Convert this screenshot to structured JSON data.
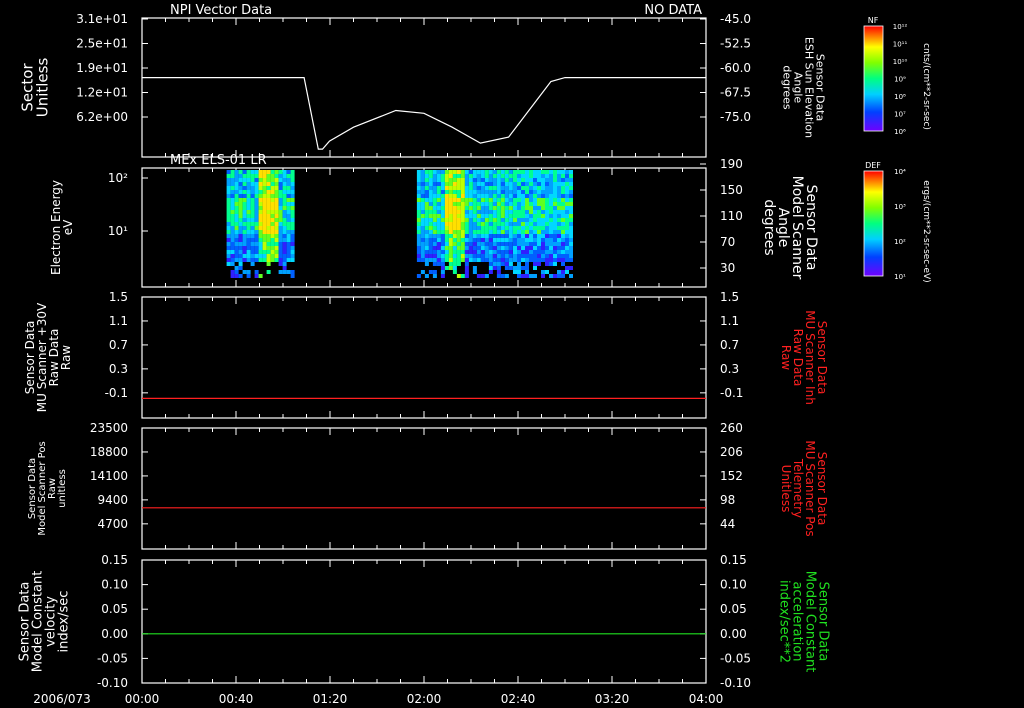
{
  "date_label": "2006/073",
  "x_ticks": [
    "00:00",
    "00:40",
    "01:20",
    "02:00",
    "02:40",
    "03:20",
    "04:00"
  ],
  "colors": {
    "red": "#ff2020",
    "green": "#20e020",
    "white": "#ffffff"
  },
  "chart_data": [
    {
      "type": "line",
      "title": "NPI Vector Data",
      "status": "NO DATA",
      "ylabel": [
        "Sector",
        "Unitless"
      ],
      "yticks_left": [
        "3.1e+01",
        "2.5e+01",
        "1.9e+01",
        "1.2e+01",
        "6.2e+00"
      ],
      "ylabel_right": [
        "Sensor Data",
        "ESH Sun Elevation",
        "Angle",
        "degrees"
      ],
      "yticks_right": [
        "-45.0",
        "-52.5",
        "-60.0",
        "-67.5",
        "-75.0"
      ],
      "ylim_right": [
        -80,
        -45
      ],
      "series": [
        {
          "x_hours": [
            0,
            1.15,
            1.25,
            1.28,
            1.33,
            1.5,
            1.8,
            2.0,
            2.2,
            2.4,
            2.6,
            2.75,
            2.9,
            3.0,
            4.0
          ],
          "values": [
            -60,
            -60,
            -78,
            -78,
            -76,
            -72.5,
            -68.3,
            -69,
            -72.5,
            -76.5,
            -75,
            -68,
            -61,
            -60,
            -60
          ]
        }
      ],
      "colorbar": {
        "label": "NF",
        "unit": "cnts/(cm**2-sr-sec)",
        "ticks": [
          "10¹²",
          "10¹¹",
          "10¹⁰",
          "10⁹",
          "10⁸",
          "10⁷",
          "10⁶"
        ]
      }
    },
    {
      "type": "heatmap",
      "title": "MEx ELS-01 LR",
      "ylabel": [
        "Electron Energy",
        "eV"
      ],
      "yticks_left": [
        "10²",
        "10¹"
      ],
      "ylabel_right": [
        "Sensor Data",
        "Model Scanner",
        "Angle",
        "degrees"
      ],
      "yticks_right": [
        "190",
        "150",
        "110",
        "70",
        "30"
      ],
      "data_blocks_hours": [
        [
          0.6,
          1.07
        ],
        [
          1.95,
          3.05
        ]
      ],
      "colorbar": {
        "label": "DEF",
        "unit": "ergs/(cm**2-sr-sec-eV)",
        "ticks": [
          "10⁴",
          "10³",
          "10²",
          "10¹"
        ]
      }
    },
    {
      "type": "line",
      "ylabel": [
        "Sensor Data",
        "MU Scanner +30V",
        "Raw Data",
        "Raw"
      ],
      "yticks_left": [
        "1.5",
        "1.1",
        "0.7",
        "0.3",
        "-0.1"
      ],
      "ylabel_right": [
        "Sensor Data",
        "MU Scanner Inh",
        "Raw Data",
        "Raw"
      ],
      "yticks_right": [
        "1.5",
        "1.1",
        "0.7",
        "0.3",
        "-0.1"
      ],
      "ylim": [
        -0.35,
        1.5
      ],
      "series": [
        {
          "color": "red",
          "constant": -0.05
        }
      ]
    },
    {
      "type": "line",
      "ylabel": [
        "Sensor Data",
        "Model Scanner Pos",
        "Raw",
        "unitless"
      ],
      "yticks_left": [
        "23500",
        "18800",
        "14100",
        "9400",
        "4700"
      ],
      "ylabel_right": [
        "Sensor Data",
        "MU Scanner Pos",
        "Telemetry",
        "Unitless"
      ],
      "yticks_right": [
        "260",
        "206",
        "152",
        "98",
        "44"
      ],
      "ylim": [
        0,
        23500
      ],
      "series": [
        {
          "color": "red",
          "constant": 8000
        }
      ]
    },
    {
      "type": "line",
      "ylabel": [
        "Sensor Data",
        "Model Constant",
        "velocity",
        "index/sec"
      ],
      "yticks_left": [
        "0.15",
        "0.10",
        "0.05",
        "0.00",
        "-0.05",
        "-0.10"
      ],
      "ylabel_right": [
        "Sensor Data",
        "Model Constant",
        "acceleration",
        "index/sec**2"
      ],
      "yticks_right": [
        "0.15",
        "0.10",
        "0.05",
        "0.00",
        "-0.05",
        "-0.10"
      ],
      "ylim": [
        -0.1,
        0.15
      ],
      "series": [
        {
          "color": "green",
          "constant": 0.0
        }
      ]
    }
  ]
}
